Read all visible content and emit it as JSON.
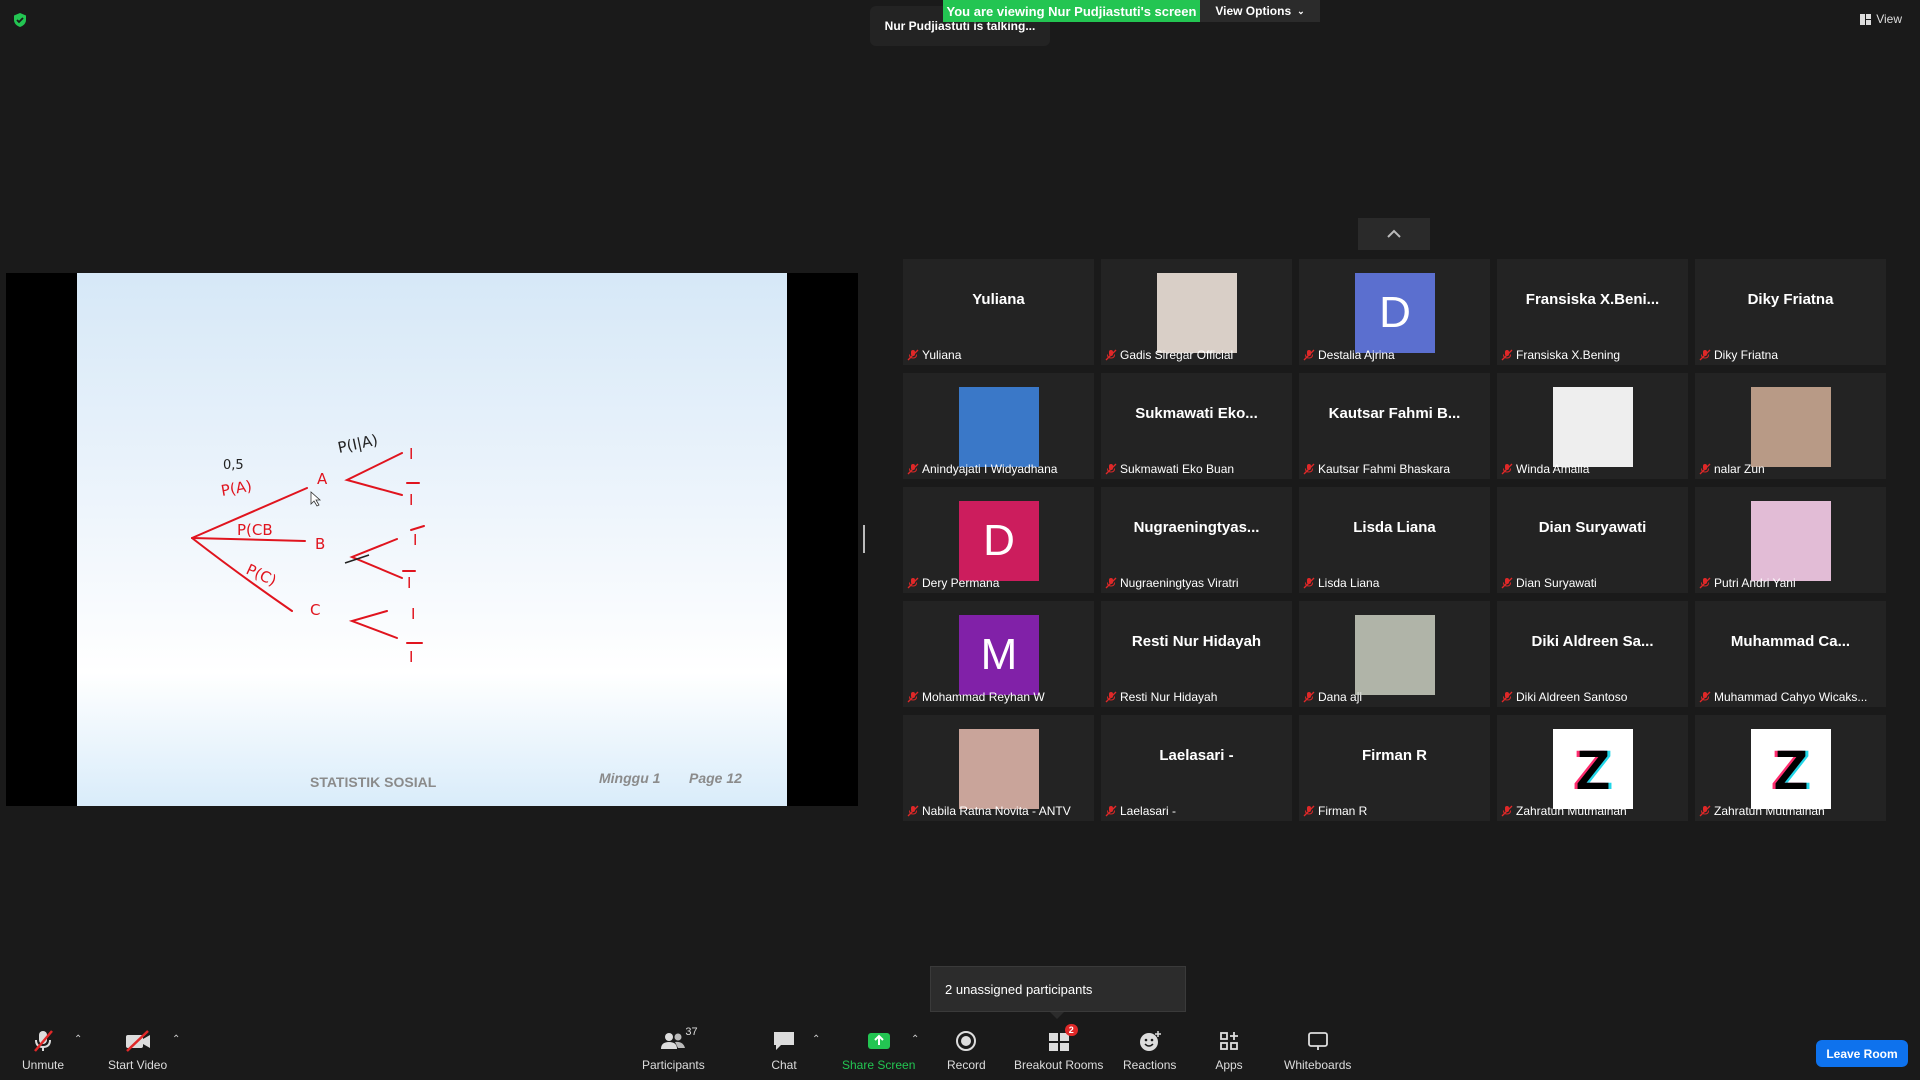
{
  "banner": {
    "viewing": "You are viewing Nur Pudjiastuti's screen",
    "view_options": "View Options"
  },
  "talking": "Nur Pudjiastuti is talking...",
  "view_button": "View",
  "slide": {
    "title": "STATISTIK SOSIAL",
    "week": "Minggu 1",
    "page": "Page 12",
    "handwriting": {
      "pa": "P(A)",
      "pb": "P(CB",
      "pc": "P(C)",
      "pia": "P(I|A)",
      "ob": "0,5",
      "a": "A",
      "b": "B",
      "c": "C",
      "i": "I"
    }
  },
  "tiles": [
    {
      "name": "Yuliana",
      "label": "Yuliana",
      "type": "name"
    },
    {
      "name": "",
      "label": "Gadis Siregar Official",
      "type": "photo",
      "color": "#d9cfc7"
    },
    {
      "name": "D",
      "label": "Destalia Ajrina",
      "type": "letter",
      "color": "#5b6fcf"
    },
    {
      "name": "Fransiska  X.Beni...",
      "label": "Fransiska X.Bening",
      "type": "name"
    },
    {
      "name": "Diky Friatna",
      "label": "Diky Friatna",
      "type": "name"
    },
    {
      "name": "",
      "label": "Anindyajati I Widyadhana",
      "type": "photo",
      "color": "#3a78c8"
    },
    {
      "name": "Sukmawati  Eko...",
      "label": "Sukmawati Eko Buan",
      "type": "name"
    },
    {
      "name": "Kautsar Fahmi B...",
      "label": "Kautsar Fahmi Bhaskara",
      "type": "name"
    },
    {
      "name": "",
      "label": "Winda Amalia",
      "type": "photo",
      "color": "#eeeeee"
    },
    {
      "name": "",
      "label": "nalar Zun",
      "type": "photo",
      "color": "#b89a86"
    },
    {
      "name": "D",
      "label": "Dery Permana",
      "type": "letter",
      "color": "#cc1d5d"
    },
    {
      "name": "Nugraeningtyas...",
      "label": "Nugraeningtyas Viratri",
      "type": "name"
    },
    {
      "name": "Lisda Liana",
      "label": "Lisda Liana",
      "type": "name"
    },
    {
      "name": "Dian Suryawati",
      "label": "Dian Suryawati",
      "type": "name"
    },
    {
      "name": "",
      "label": "Putri Andri Yani",
      "type": "photo",
      "color": "#e2bcd6"
    },
    {
      "name": "M",
      "label": "Mohammad Reyhan W",
      "type": "letter",
      "color": "#8121a8"
    },
    {
      "name": "Resti Nur Hidayah",
      "label": "Resti Nur Hidayah",
      "type": "name"
    },
    {
      "name": "",
      "label": "Dana aji",
      "type": "photo",
      "color": "#b0b4a8"
    },
    {
      "name": "Diki Aldreen  Sa...",
      "label": "Diki Aldreen Santoso",
      "type": "name"
    },
    {
      "name": "Muhammad  Ca...",
      "label": "Muhammad Cahyo Wicaks...",
      "type": "name"
    },
    {
      "name": "",
      "label": "Nabila Ratna Novita - ANTV",
      "type": "photo",
      "color": "#c9a49a"
    },
    {
      "name": "Laelasari -",
      "label": "Laelasari -",
      "type": "name"
    },
    {
      "name": "Firman R",
      "label": "Firman R",
      "type": "name"
    },
    {
      "name": "Z",
      "label": "Zahratun Mutmainah",
      "type": "zlogo",
      "color": "#ffffff"
    },
    {
      "name": "Z",
      "label": "Zahratun Mutmainah",
      "type": "zlogo",
      "color": "#ffffff"
    }
  ],
  "popup": "2 unassigned participants",
  "toolbar": {
    "unmute": "Unmute",
    "start_video": "Start Video",
    "participants": "Participants",
    "participants_count": "37",
    "chat": "Chat",
    "share_screen": "Share Screen",
    "record": "Record",
    "breakout_rooms": "Breakout Rooms",
    "breakout_badge": "2",
    "reactions": "Reactions",
    "apps": "Apps",
    "whiteboards": "Whiteboards",
    "leave": "Leave Room"
  }
}
